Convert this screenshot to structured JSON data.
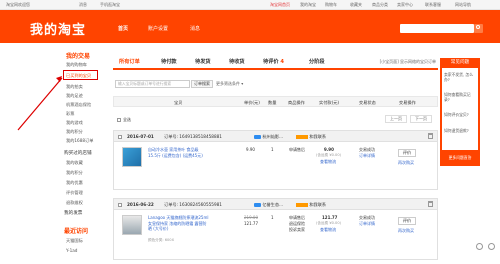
{
  "topbar": {
    "greeting": "淘宝网欢迎您",
    "username": "",
    "messages": "消息",
    "mobile": "手机逛淘宝",
    "right_links": [
      "淘宝网首页",
      "我的淘宝",
      "购物车",
      "收藏夹",
      "商品分类",
      "卖家中心",
      "联系客服",
      "网站导航"
    ]
  },
  "header": {
    "logo": "我的淘宝",
    "nav": [
      "首页",
      "账户设置",
      "消息"
    ]
  },
  "sidebar": {
    "section1_title": "我的交易",
    "items1": [
      "我的购物车",
      "已买到的宝贝",
      "我的拍卖",
      "我的足迹",
      "机票酒店保险",
      "彩票",
      "我的游戏",
      "我的积分",
      "我的1688订单"
    ],
    "section2": [
      {
        "title": "购买过的店铺",
        "items": [
          "我的收藏",
          "我的积分",
          "我的优惠",
          "评价管理",
          "退款维权"
        ]
      },
      {
        "title": "我的发票",
        "items": []
      }
    ],
    "section3_title": "最近访问",
    "recent": [
      "天猫国际",
      "Y-1ad"
    ]
  },
  "tabs": {
    "items": [
      {
        "label": "所有订单",
        "count": ""
      },
      {
        "label": "待付款",
        "count": ""
      },
      {
        "label": "待发货",
        "count": ""
      },
      {
        "label": "待收货",
        "count": ""
      },
      {
        "label": "待评价",
        "count": "4"
      },
      {
        "label": "分阶段",
        "count": ""
      }
    ],
    "right_links": "[小宝页面] 显示网络的宝贝订单"
  },
  "search": {
    "placeholder": "输入宝贝标题或订单号进行搜索",
    "button": "订单搜索",
    "more": "更多筛选条件 ▾"
  },
  "table": {
    "headers": [
      "宝贝",
      "单价(元)",
      "数量",
      "商品操作",
      "实付款(元)",
      "交易状态",
      "交易操作"
    ],
    "select_all": "全选",
    "prev": "上一页",
    "next": "下一页"
  },
  "orders": [
    {
      "date": "2016-07-01",
      "order_no": "订单号: 1649138518458881",
      "shop": "杭州灿影...",
      "contact": "和我联系",
      "title": "自动冷水壶 家用茶叶 食品级 15.5斤 (运费包含) (运费45元)",
      "badge": "",
      "price": "9.90",
      "qty": "1",
      "action": "申请售后",
      "paid": "9.90",
      "paid_sub": "(含运费 ¥0.00)",
      "paid_detail": "查看物流",
      "status": "交易成功",
      "status_sub": "订单详情",
      "btn": "评价",
      "btn_sub": "再次购买"
    },
    {
      "date": "2016-06-22",
      "order_no": "订单号: 1630824560555981",
      "shop": "亿誉生态...",
      "contact": "和我联系",
      "title": "Lanagoo 天猫旗舰防摔潮流25ml 女皇保持家 浓缩的防晒霜 露营防晒 (大号价)",
      "badge": "颜色分类: 600X",
      "orig_price": "219.00",
      "price": "121.77",
      "qty": "1",
      "action": "申请售后",
      "action2": "退运保险",
      "action3": "投诉卖家",
      "paid": "121.77",
      "paid_sub": "(含运费 ¥0.00)",
      "paid_detail": "查看物流",
      "status": "交易成功",
      "status_sub": "订单详情",
      "btn": "评价",
      "btn_sub": "再次购买"
    }
  ],
  "float_panel": {
    "title": "常见问题",
    "questions": [
      "卖家不发货, 怎么办?",
      "如何查看购买记录?",
      "如何评价宝贝?",
      "如何退货退款?"
    ],
    "footer": "更多问题直答"
  },
  "colors": {
    "brand": "#ff4400",
    "highlight_box": "#dd0000"
  }
}
